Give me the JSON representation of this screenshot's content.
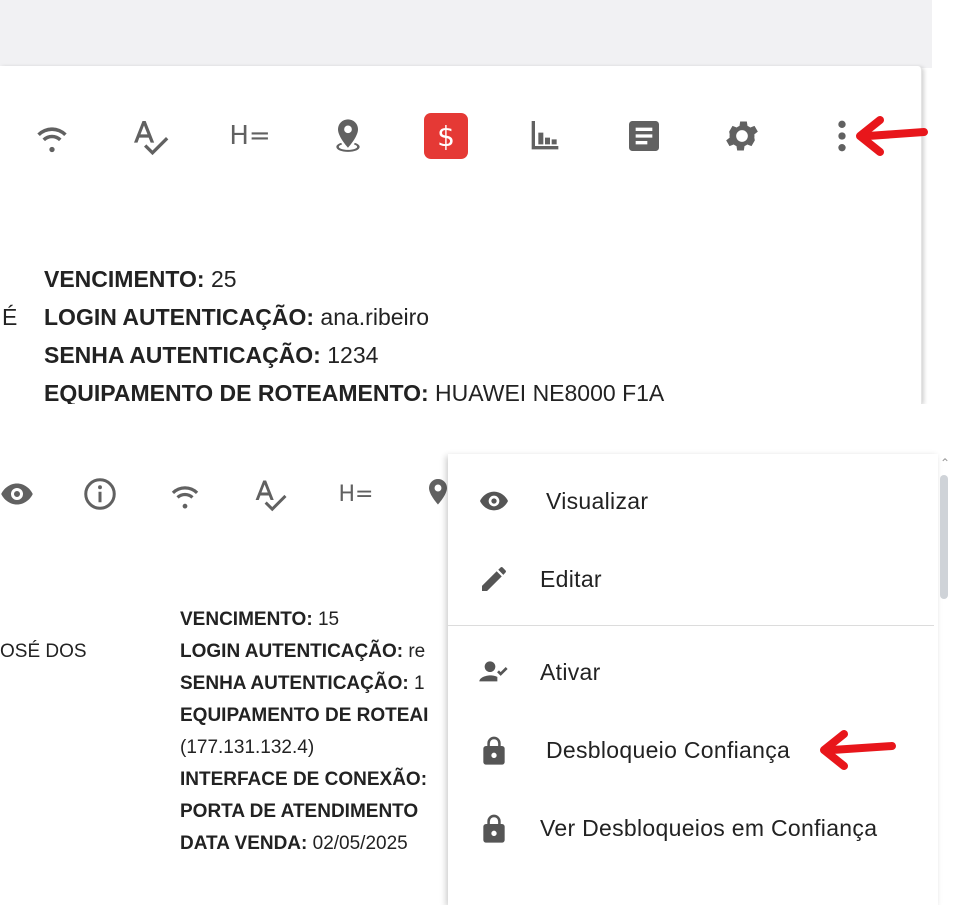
{
  "top_panel": {
    "info_lines": [
      {
        "label": "VENCIMENTO:",
        "value": "25"
      },
      {
        "label": "LOGIN AUTENTICAÇÃO:",
        "value": "ana.ribeiro"
      },
      {
        "label": "SENHA AUTENTICAÇÃO:",
        "value": "1234"
      },
      {
        "label": "EQUIPAMENTO DE ROTEAMENTO:",
        "value": "HUAWEI NE8000 F1A"
      }
    ],
    "left_fragment": "É",
    "toolbar_icons": [
      "wifi-icon",
      "spellcheck-icon",
      "text-format-icon",
      "location-pin-icon",
      "dollar-icon",
      "bar-chart-icon",
      "document-icon",
      "gear-icon",
      "more-vert-icon"
    ],
    "h_equals_glyph": "H=",
    "dollar_glyph": "$"
  },
  "bottom_panel": {
    "left_fragment": "OSÉ DOS",
    "info_lines": [
      {
        "label": "VENCIMENTO:",
        "value": "15"
      },
      {
        "label": "LOGIN AUTENTICAÇÃO:",
        "value": "re"
      },
      {
        "label": "SENHA AUTENTICAÇÃO:",
        "value": "1"
      },
      {
        "label": "EQUIPAMENTO DE ROTEAI",
        "value": ""
      },
      {
        "label": "",
        "value": "(177.131.132.4)"
      },
      {
        "label": "INTERFACE DE CONEXÃO:",
        "value": ""
      },
      {
        "label": "PORTA DE ATENDIMENTO",
        "value": ""
      },
      {
        "label": "DATA VENDA:",
        "value": "02/05/2025"
      }
    ],
    "toolbar_icons": [
      "eye-icon",
      "info-icon",
      "wifi-icon",
      "spellcheck-icon",
      "text-format-icon",
      "location-pin-icon"
    ],
    "h_equals_glyph": "H="
  },
  "menu": {
    "items": [
      {
        "label": "Visualizar",
        "icon": "eye-icon"
      },
      {
        "label": "Editar",
        "icon": "pencil-icon"
      },
      {
        "label": "Ativar",
        "icon": "person-check-icon"
      },
      {
        "label": "Desbloqueio Confiança",
        "icon": "lock-icon"
      },
      {
        "label": "Ver Desbloqueios em Confiança",
        "icon": "lock-icon"
      }
    ]
  },
  "annotations": {
    "arrow_color": "#e8161b",
    "accent_red": "#e53935",
    "icon_gray": "#616161"
  }
}
